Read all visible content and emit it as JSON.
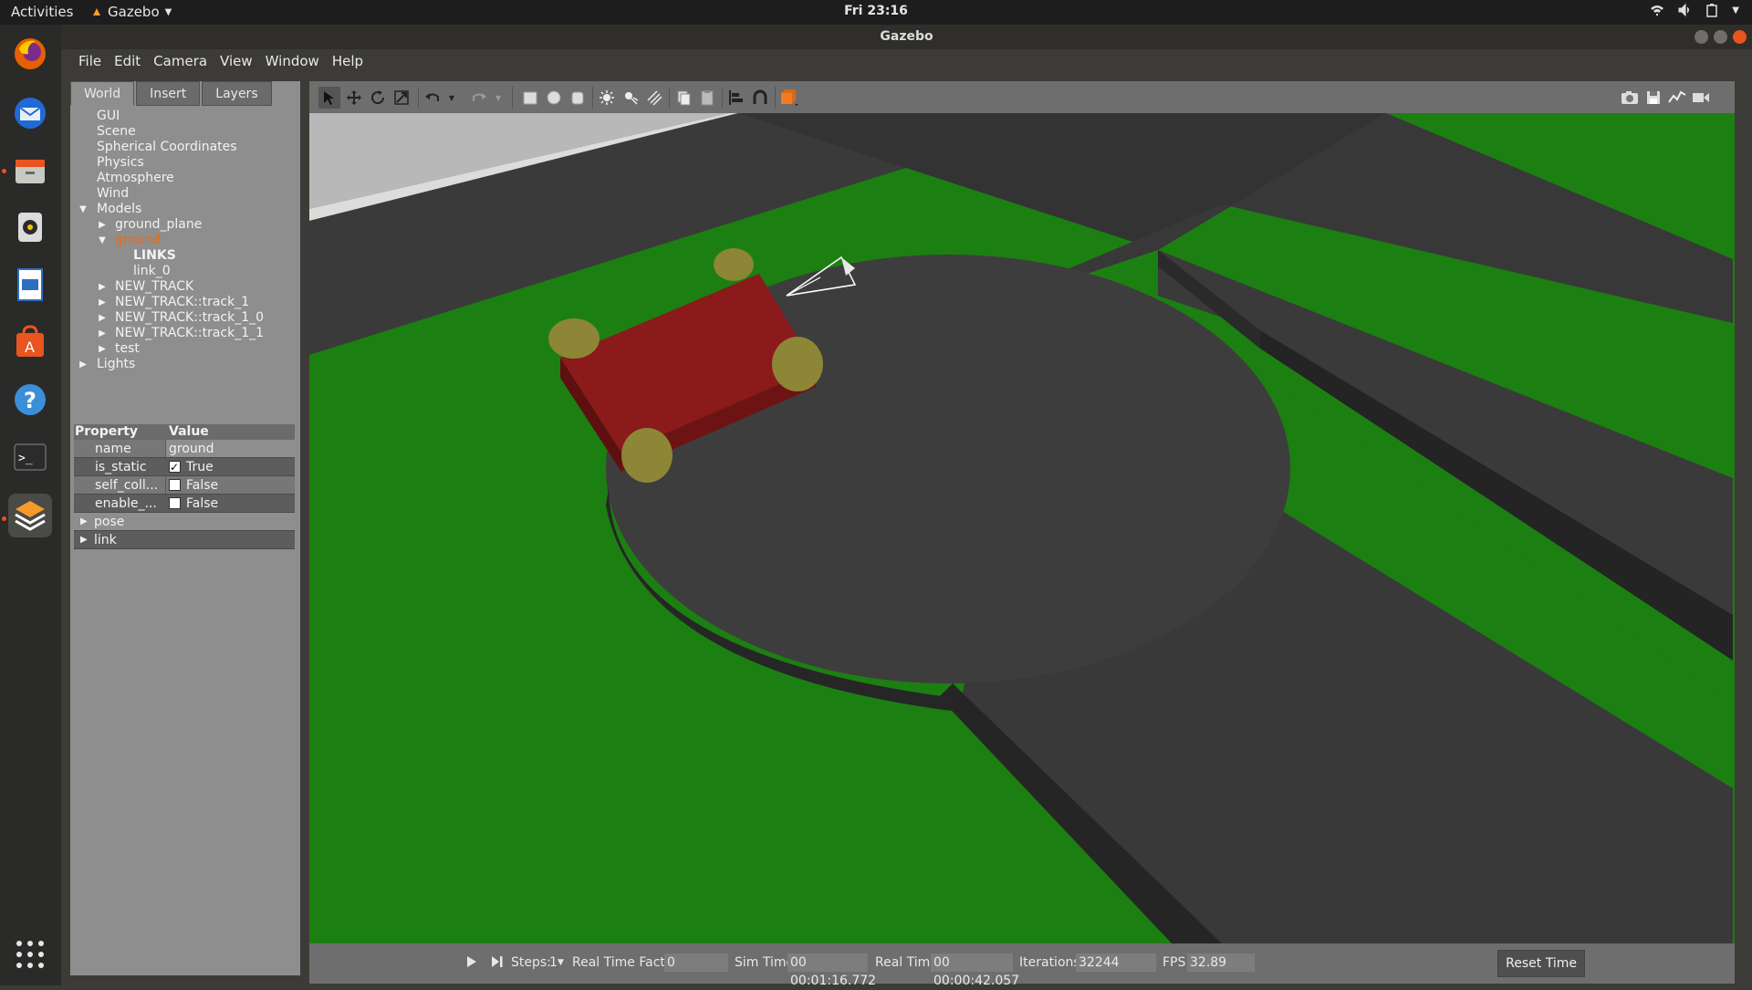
{
  "topbar": {
    "activities": "Activities",
    "app_name": "Gazebo",
    "clock": "Fri 23:16"
  },
  "window": {
    "title": "Gazebo"
  },
  "menus": [
    "File",
    "Edit",
    "Camera",
    "View",
    "Window",
    "Help"
  ],
  "tabs": [
    "World",
    "Insert",
    "Layers"
  ],
  "tree": {
    "gui": "GUI",
    "scene": "Scene",
    "spherical": "Spherical Coordinates",
    "physics": "Physics",
    "atmosphere": "Atmosphere",
    "wind": "Wind",
    "models": "Models",
    "ground_plane": "ground_plane",
    "ground": "ground",
    "links": "LINKS",
    "link_0": "link_0",
    "new_track": "NEW_TRACK",
    "track_1": "NEW_TRACK::track_1",
    "track_1_0": "NEW_TRACK::track_1_0",
    "track_1_1": "NEW_TRACK::track_1_1",
    "test": "test",
    "lights": "Lights"
  },
  "properties": {
    "header_property": "Property",
    "header_value": "Value",
    "rows": [
      {
        "name": "name",
        "value": "ground"
      },
      {
        "name": "is_static",
        "value": "True",
        "checked": true
      },
      {
        "name": "self_coll...",
        "value": "False",
        "checked": false
      },
      {
        "name": "enable_...",
        "value": "False",
        "checked": false
      }
    ],
    "groups": [
      "pose",
      "link"
    ]
  },
  "status": {
    "steps_label": "Steps:",
    "steps_value": "1",
    "rtf_label": "Real Time Factor:",
    "rtf_value": "0",
    "sim_label": "Sim Time:",
    "sim_value": "00 00:01:16.772",
    "real_label": "Real Time:",
    "real_value": "00 00:00:42.057",
    "iter_label": "Iterations:",
    "iter_value": "32244",
    "fps_label": "FPS:",
    "fps_value": "32.89",
    "reset_label": "Reset Time"
  },
  "colors": {
    "accent": "#e95420",
    "grass": "#1c7f12",
    "track": "#3a3a3a",
    "car_body": "#8b1a1a",
    "wheel": "#8c8636",
    "selected_text": "#e66a12"
  }
}
